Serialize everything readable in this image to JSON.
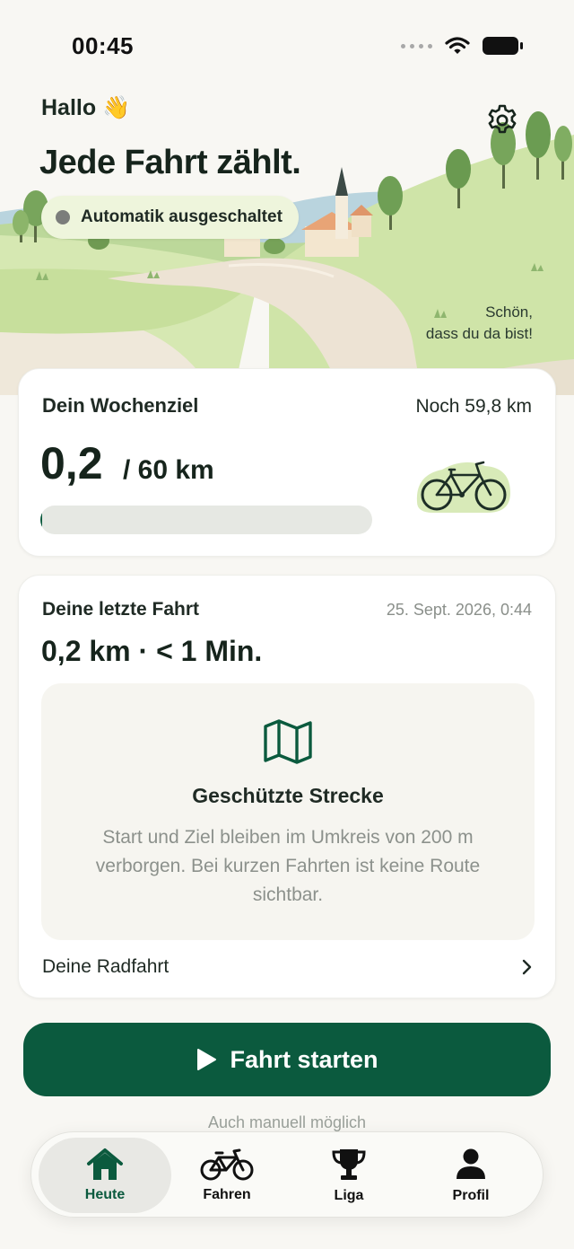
{
  "status_bar": {
    "time": "00:45"
  },
  "hero": {
    "greeting": "Hallo 👋",
    "headline": "Jede Fahrt zählt.",
    "automation_status": "Automatik ausgeschaltet",
    "welcome_line1": "Schön,",
    "welcome_line2": "dass du da bist!"
  },
  "weekly_goal": {
    "title": "Dein Wochenziel",
    "remaining": "Noch 59,8 km",
    "current": "0,2",
    "target": "/ 60 km",
    "progress_fraction": 0.0033
  },
  "last_ride": {
    "title": "Deine letzte Fahrt",
    "date": "25. Sept. 2026, 0:44",
    "stats": "0,2 km · < 1 Min.",
    "protected_title": "Geschützte Strecke",
    "protected_text": "Start und Ziel bleiben im Umkreis von 200 m verborgen. Bei kurzen Fahrten ist keine Route sichtbar.",
    "link_label": "Deine Radfahrt"
  },
  "actions": {
    "start_label": "Fahrt starten",
    "manual_hint": "Auch manuell möglich"
  },
  "tabs": [
    {
      "label": "Heute",
      "icon": "home-icon",
      "active": true
    },
    {
      "label": "Fahren",
      "icon": "bicycle-icon",
      "active": false
    },
    {
      "label": "Liga",
      "icon": "trophy-icon",
      "active": false
    },
    {
      "label": "Profil",
      "icon": "person-icon",
      "active": false
    }
  ],
  "colors": {
    "brand_green": "#0b5a3e",
    "background": "#f8f7f3",
    "card": "#ffffff",
    "pill": "#eef5dc",
    "muted_text": "#8c918c"
  }
}
